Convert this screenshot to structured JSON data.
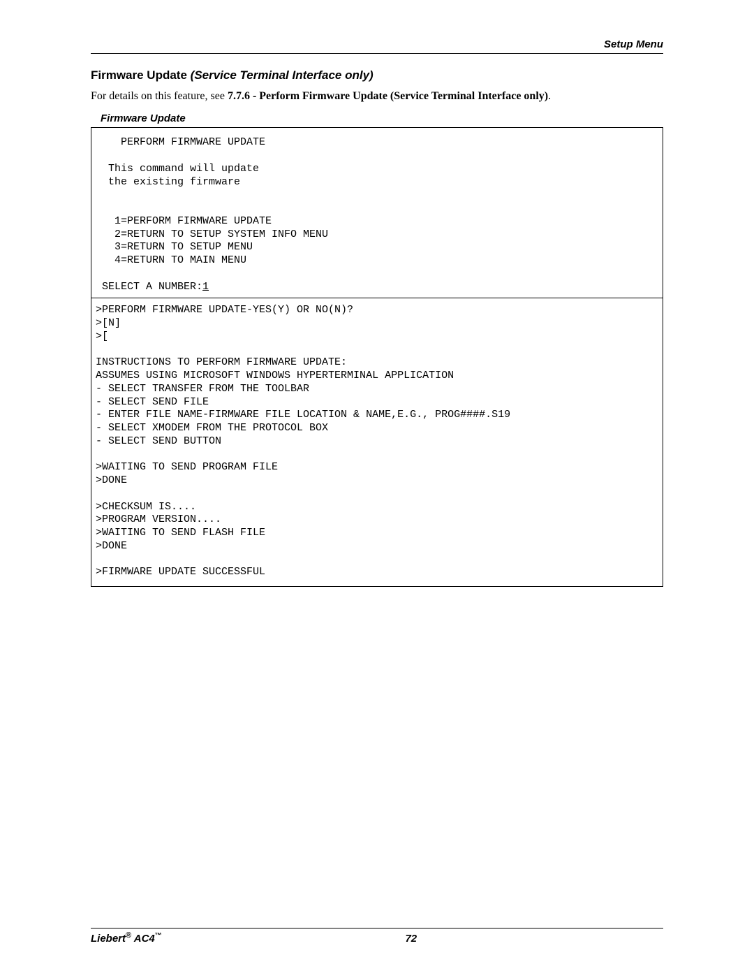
{
  "header": {
    "section": "Setup Menu"
  },
  "title": {
    "bold": "Firmware Update ",
    "italic": "(Service Terminal Interface only)"
  },
  "intro": {
    "prefix": "For details on this feature, see ",
    "bold": "7.7.6 - Perform Firmware Update (Service Terminal Interface only)",
    "suffix": "."
  },
  "figure_caption": "Firmware Update",
  "terminal": {
    "header": "    PERFORM FIRMWARE UPDATE",
    "desc1": "  This command will update",
    "desc2": "  the existing firmware",
    "opt1": "   1=PERFORM FIRMWARE UPDATE",
    "opt2": "   2=RETURN TO SETUP SYSTEM INFO MENU",
    "opt3": "   3=RETURN TO SETUP MENU",
    "opt4": "   4=RETURN TO MAIN MENU",
    "prompt": " SELECT A NUMBER:",
    "prompt_val": "1",
    "l1": ">PERFORM FIRMWARE UPDATE-YES(Y) OR NO(N)?",
    "l2": ">[N]",
    "l3": ">[",
    "inst0": "INSTRUCTIONS TO PERFORM FIRMWARE UPDATE:",
    "inst1": "ASSUMES USING MICROSOFT WINDOWS HYPERTERMINAL APPLICATION",
    "inst2": "- SELECT TRANSFER FROM THE TOOLBAR",
    "inst3": "- SELECT SEND FILE",
    "inst4": "- ENTER FILE NAME-FIRMWARE FILE LOCATION & NAME,E.G., PROG####.S19",
    "inst5": "- SELECT XMODEM FROM THE PROTOCOL BOX",
    "inst6": "- SELECT SEND BUTTON",
    "s1": ">WAITING TO SEND PROGRAM FILE",
    "s2": ">DONE",
    "s3": ">CHECKSUM IS....",
    "s4": ">PROGRAM VERSION....",
    "s5": ">WAITING TO SEND FLASH FILE",
    "s6": ">DONE",
    "s7": ">FIRMWARE UPDATE SUCCESSFUL"
  },
  "footer": {
    "brand": "Liebert",
    "product": " AC4",
    "page": "72"
  }
}
